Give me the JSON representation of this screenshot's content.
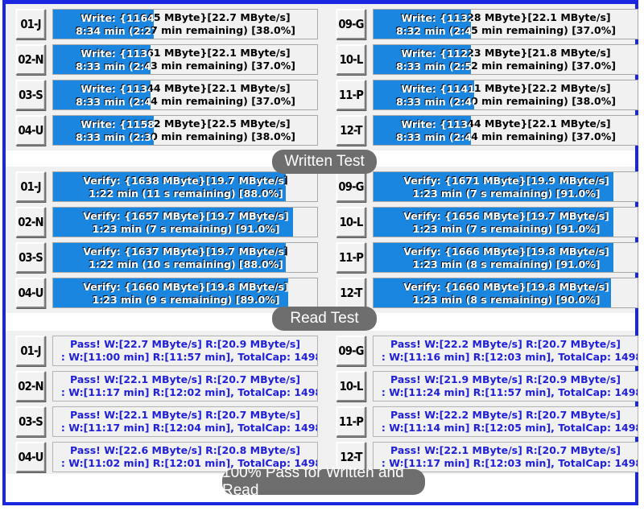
{
  "captions": {
    "written": "Written Test",
    "read": "Read Test",
    "pass": "100% Pass for Written and Read"
  },
  "written_test": {
    "left": [
      {
        "slot": "01-J",
        "line1": "Write: {11645 MByte}[22.7 MByte/s]",
        "line2": "8:34 min (2:27 min remaining)   [38.0%]",
        "percent": 38.0
      },
      {
        "slot": "02-N",
        "line1": "Write: {11361 MByte}[22.1 MByte/s]",
        "line2": "8:33 min (2:43 min remaining)   [37.0%]",
        "percent": 37.0
      },
      {
        "slot": "03-S",
        "line1": "Write: {11344 MByte}[22.1 MByte/s]",
        "line2": "8:33 min (2:44 min remaining)   [37.0%]",
        "percent": 37.0
      },
      {
        "slot": "04-U",
        "line1": "Write: {11582 MByte}[22.5 MByte/s]",
        "line2": "8:33 min (2:30 min remaining)   [38.0%]",
        "percent": 38.0
      }
    ],
    "right": [
      {
        "slot": "09-G",
        "line1": "Write: {11328 MByte}[22.1 MByte/s]",
        "line2": "8:32 min (2:45 min remaining)   [37.0%]",
        "percent": 37.0
      },
      {
        "slot": "10-L",
        "line1": "Write: {11223 MByte}[21.8 MByte/s]",
        "line2": "8:33 min (2:52 min remaining)   [37.0%]",
        "percent": 37.0
      },
      {
        "slot": "11-P",
        "line1": "Write: {11411 MByte}[22.2 MByte/s]",
        "line2": "8:33 min (2:40 min remaining)   [38.0%]",
        "percent": 38.0
      },
      {
        "slot": "12-T",
        "line1": "Write: {11344 MByte}[22.1 MByte/s]",
        "line2": "8:33 min (2:44 min remaining)   [37.0%]",
        "percent": 37.0
      }
    ]
  },
  "read_test": {
    "left": [
      {
        "slot": "01-J",
        "line1": "Verify: {1638 MByte}[19.7 MByte/s]",
        "line2": "1:22 min (11 s remaining)   [88.0%]",
        "percent": 88.0
      },
      {
        "slot": "02-N",
        "line1": "Verify: {1657 MByte}[19.7 MByte/s]",
        "line2": "1:23 min (7 s remaining)   [91.0%]",
        "percent": 91.0
      },
      {
        "slot": "03-S",
        "line1": "Verify: {1637 MByte}[19.7 MByte/s]",
        "line2": "1:22 min (10 s remaining)   [88.0%]",
        "percent": 88.0
      },
      {
        "slot": "04-U",
        "line1": "Verify: {1660 MByte}[19.8 MByte/s]",
        "line2": "1:23 min (9 s remaining)   [89.0%]",
        "percent": 89.0
      }
    ],
    "right": [
      {
        "slot": "09-G",
        "line1": "Verify: {1671 MByte}[19.9 MByte/s]",
        "line2": "1:23 min (7 s remaining)   [91.0%]",
        "percent": 91.0
      },
      {
        "slot": "10-L",
        "line1": "Verify: {1656 MByte}[19.7 MByte/s]",
        "line2": "1:23 min (7 s remaining)   [91.0%]",
        "percent": 91.0
      },
      {
        "slot": "11-P",
        "line1": "Verify: {1666 MByte}[19.8 MByte/s]",
        "line2": "1:23 min (8 s remaining)   [91.0%]",
        "percent": 91.0
      },
      {
        "slot": "12-T",
        "line1": "Verify: {1660 MByte}[19.8 MByte/s]",
        "line2": "1:23 min (8 s remaining)   [90.0%]",
        "percent": 90.0
      }
    ]
  },
  "pass_results": {
    "left": [
      {
        "slot": "01-J",
        "line1": "Pass! W:[22.7 MByte/s] R:[20.9 MByte/s]",
        "line2": ": W:[11:00 min] R:[11:57 min], TotalCap: 1498"
      },
      {
        "slot": "02-N",
        "line1": "Pass! W:[22.1 MByte/s] R:[20.7 MByte/s]",
        "line2": ": W:[11:17 min] R:[12:02 min], TotalCap: 1498"
      },
      {
        "slot": "03-S",
        "line1": "Pass! W:[22.1 MByte/s] R:[20.7 MByte/s]",
        "line2": ": W:[11:17 min] R:[12:04 min], TotalCap: 1498"
      },
      {
        "slot": "04-U",
        "line1": "Pass! W:[22.6 MByte/s] R:[20.8 MByte/s]",
        "line2": ": W:[11:02 min] R:[12:01 min], TotalCap: 1498"
      }
    ],
    "right": [
      {
        "slot": "09-G",
        "line1": "Pass! W:[22.2 MByte/s] R:[20.7 MByte/s]",
        "line2": ": W:[11:16 min] R:[12:03 min], TotalCap: 1498"
      },
      {
        "slot": "10-L",
        "line1": "Pass! W:[21.9 MByte/s] R:[20.9 MByte/s]",
        "line2": ": W:[11:24 min] R:[11:57 min], TotalCap: 1498"
      },
      {
        "slot": "11-P",
        "line1": "Pass! W:[22.2 MByte/s] R:[20.7 MByte/s]",
        "line2": ": W:[11:14 min] R:[12:05 min], TotalCap: 1498"
      },
      {
        "slot": "12-T",
        "line1": "Pass! W:[22.1 MByte/s] R:[20.7 MByte/s]",
        "line2": ": W:[11:17 min] R:[12:03 min], TotalCap: 1498"
      }
    ]
  },
  "colors": {
    "progress_fill": "#1a86e0",
    "frame_border": "#1a26e0",
    "pass_text": "#2020d8",
    "caption_bg": "#6e6e6e"
  }
}
